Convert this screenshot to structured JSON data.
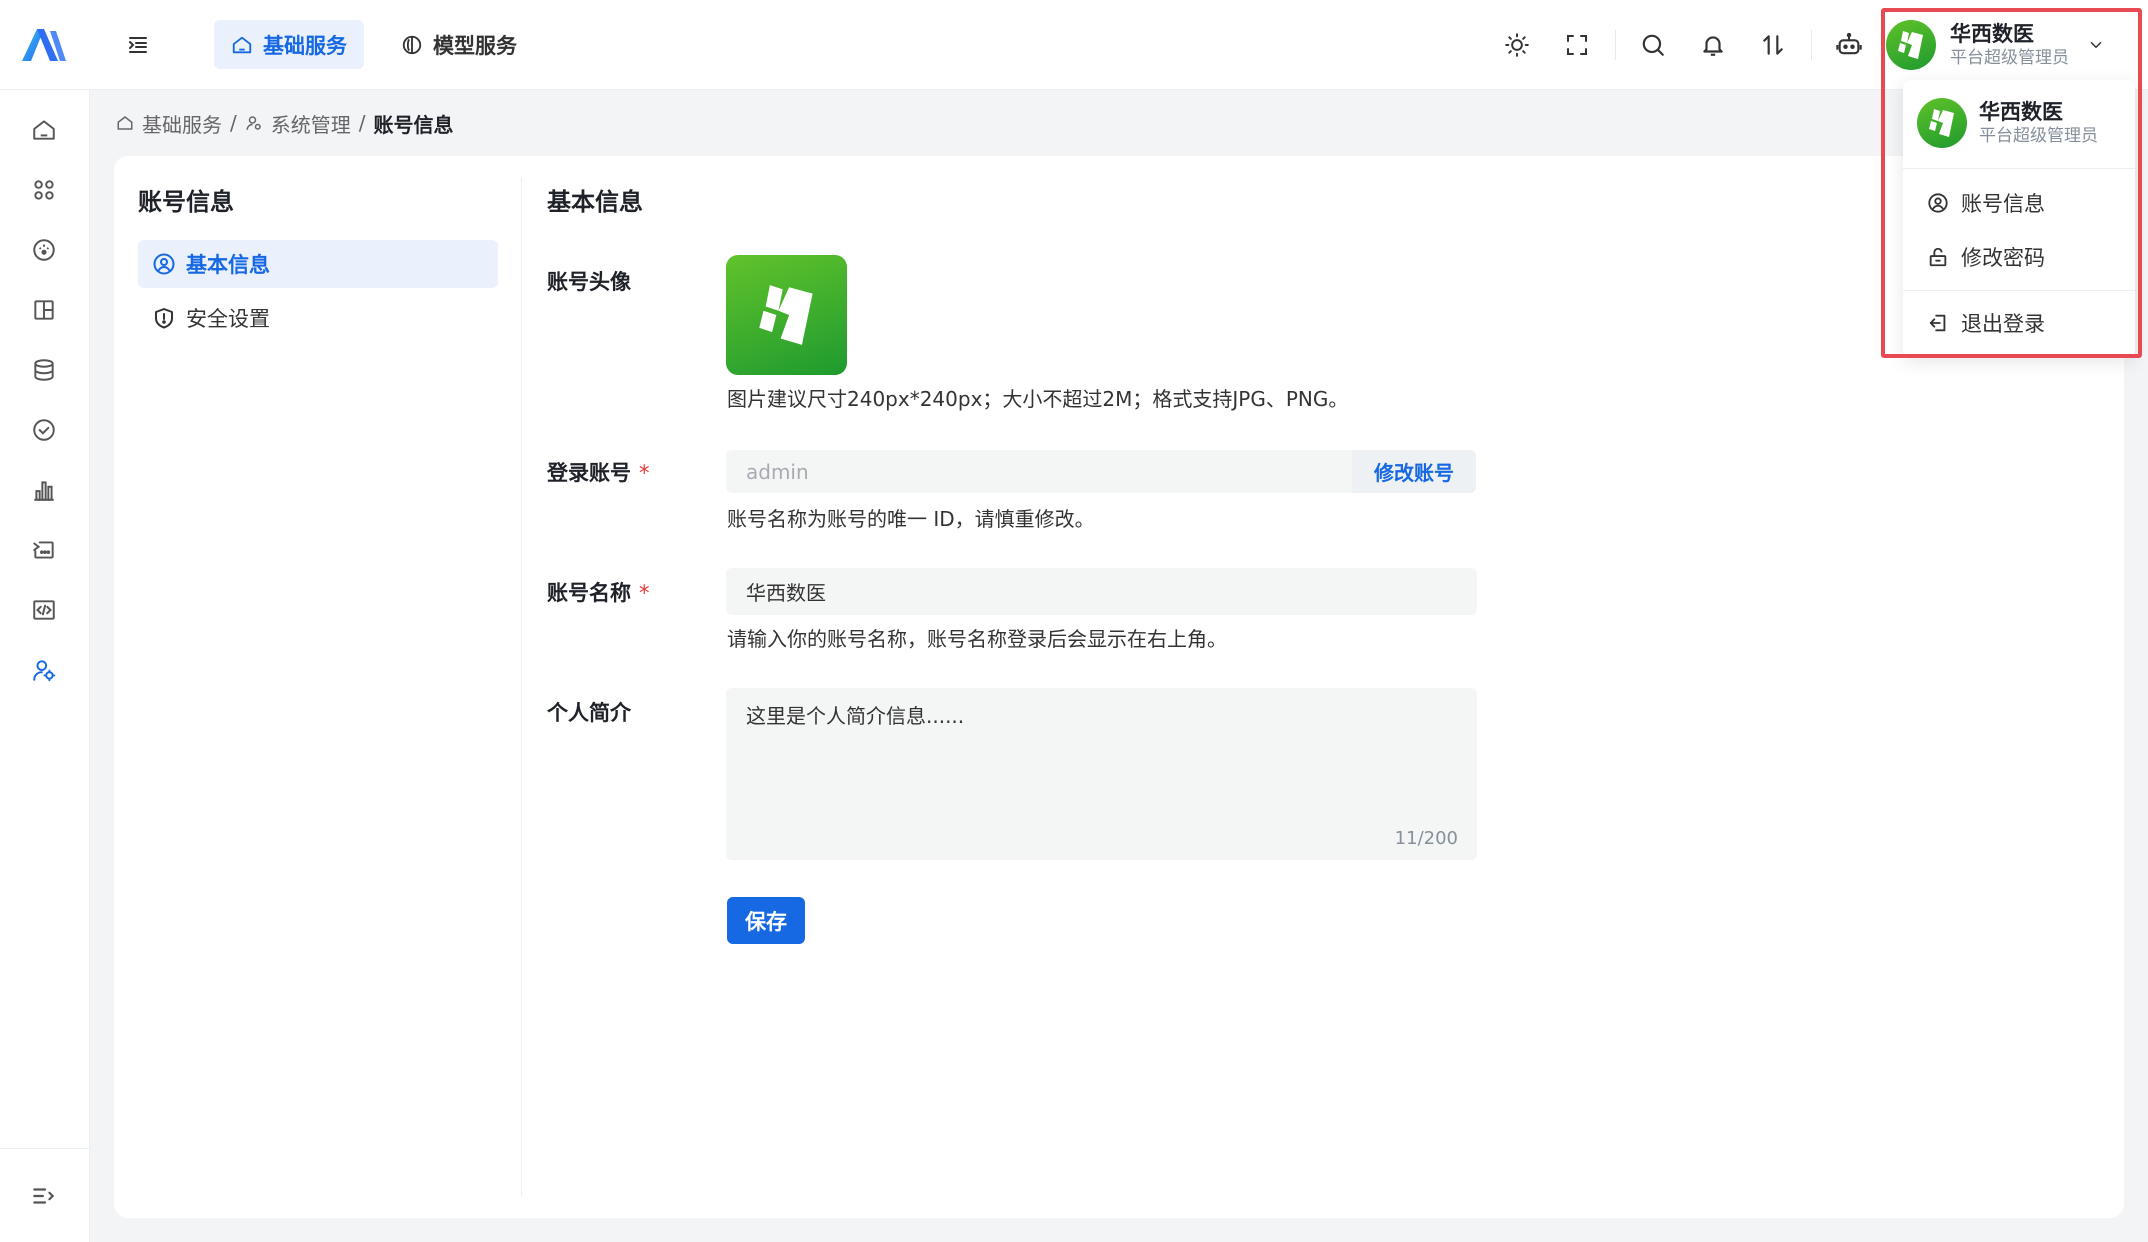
{
  "topbar": {
    "tabs": [
      {
        "label": "基础服务",
        "active": true
      },
      {
        "label": "模型服务",
        "active": false
      }
    ],
    "user": {
      "name": "华西数医",
      "role": "平台超级管理员"
    }
  },
  "breadcrumb": {
    "items": [
      "基础服务",
      "系统管理",
      "账号信息"
    ],
    "separator": "/"
  },
  "left_panel": {
    "title": "账号信息",
    "menu": [
      {
        "label": "基本信息",
        "active": true
      },
      {
        "label": "安全设置",
        "active": false
      }
    ]
  },
  "form": {
    "title": "基本信息",
    "avatar": {
      "label": "账号头像",
      "hint": "图片建议尺寸240px*240px；大小不超过2M；格式支持JPG、PNG。"
    },
    "login": {
      "label": "登录账号",
      "required_mark": "*",
      "placeholder": "admin",
      "action": "修改账号",
      "hint": "账号名称为账号的唯一 ID，请慎重修改。"
    },
    "name": {
      "label": "账号名称",
      "required_mark": "*",
      "value": "华西数医",
      "hint": "请输入你的账号名称，账号名称登录后会显示在右上角。"
    },
    "bio": {
      "label": "个人简介",
      "value": "这里是个人简介信息......",
      "counter": "11/200"
    },
    "save_label": "保存"
  },
  "dropdown": {
    "name": "华西数医",
    "role": "平台超级管理员",
    "items": [
      "账号信息",
      "修改密码",
      "退出登录"
    ]
  },
  "colors": {
    "primary": "#1668e3",
    "highlight_border": "#e84a53",
    "avatar_green": "#1f9a2e"
  }
}
